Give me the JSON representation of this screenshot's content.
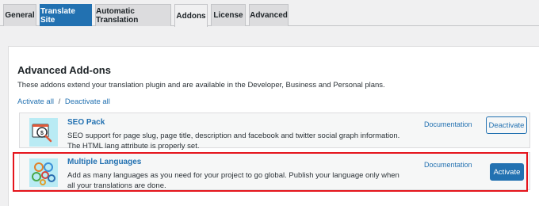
{
  "tabs": [
    {
      "label": "General"
    },
    {
      "label": "Translate Site"
    },
    {
      "label": "Automatic Translation"
    },
    {
      "label": "Addons"
    },
    {
      "label": "License"
    },
    {
      "label": "Advanced"
    }
  ],
  "section": {
    "heading": "Advanced Add-ons",
    "description": "These addons extend your translation plugin and are available in the Developer, Business and Personal plans.",
    "activate_all": "Activate all",
    "separator": "/",
    "deactivate_all": "Deactivate all"
  },
  "addons": [
    {
      "title": "SEO Pack",
      "description": "SEO support for page slug, page title, description and facebook and twitter social graph information. The HTML lang attribute is properly set.",
      "doc_label": "Documentation",
      "action_label": "Deactivate",
      "icon": "seo-magnifier-icon"
    },
    {
      "title": "Multiple Languages",
      "description": "Add as many languages as you need for your project to go global. Publish your language only when all your translations are done.",
      "doc_label": "Documentation",
      "action_label": "Activate",
      "icon": "multiple-languages-circles-icon"
    }
  ],
  "colors": {
    "accent": "#2271b1",
    "highlight_border": "#e5141c",
    "thumb_bg": "#b9ebf4"
  }
}
